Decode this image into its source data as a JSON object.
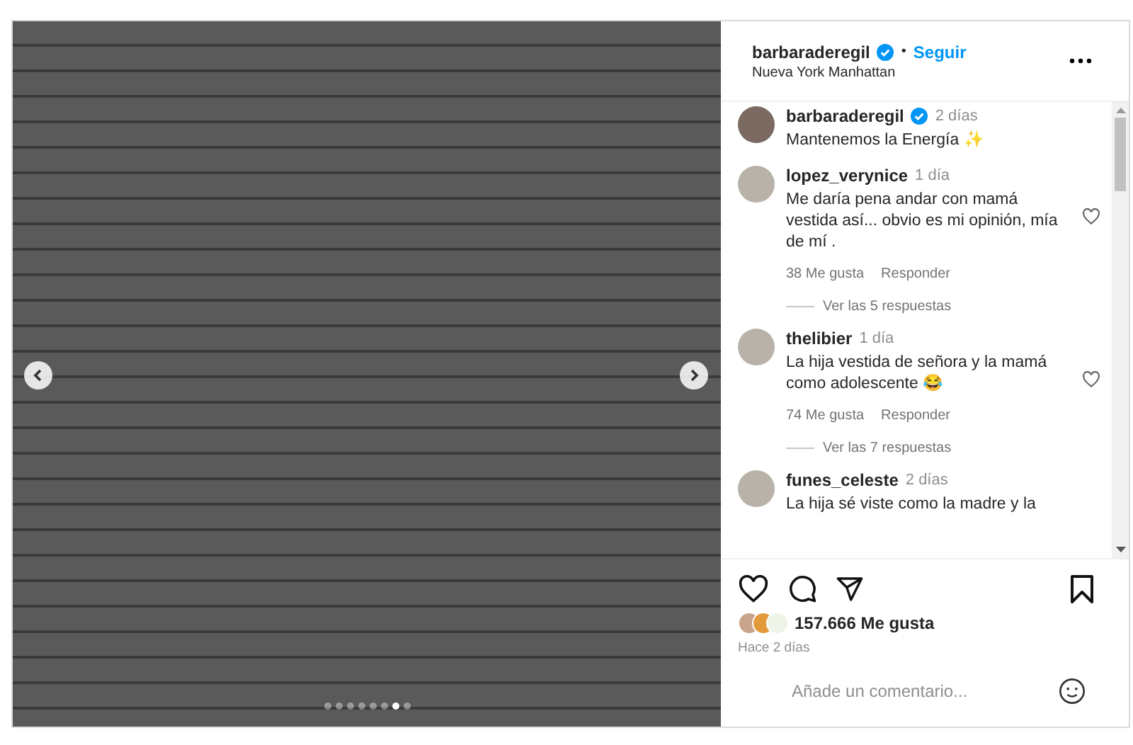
{
  "post": {
    "carousel_dots": [
      {
        "selected": false
      },
      {
        "selected": false
      },
      {
        "selected": false
      },
      {
        "selected": false
      },
      {
        "selected": false
      },
      {
        "selected": false
      },
      {
        "selected": true
      },
      {
        "selected": false
      }
    ]
  },
  "header": {
    "username": "barbaraderegil",
    "verified": true,
    "separator": "•",
    "follow": "Seguir",
    "location": "Nueva York Manhattan"
  },
  "caption": {
    "username": "barbaraderegil",
    "verified": true,
    "time": "2 días",
    "text": "Mantenemos la Energía ✨"
  },
  "comments": [
    {
      "username": "lopez_verynice",
      "time": "1 día",
      "text": "Me daría pena andar con mamá vestida así... obvio es mi opinión, mía de mí .",
      "likes": "38 Me gusta",
      "reply": "Responder",
      "replies": "Ver las 5 respuestas"
    },
    {
      "username": "thelibier",
      "time": "1 día",
      "text": "La hija vestida de señora y la mamá como adolescente 😂",
      "likes": "74 Me gusta",
      "reply": "Responder",
      "replies": "Ver las 7 respuestas"
    },
    {
      "username": "funes_celeste",
      "time": "2 días",
      "text": "La hija sé viste como la madre y la"
    }
  ],
  "likes": "157.666 Me gusta",
  "posted": "Hace 2 días",
  "comment_box": {
    "placeholder": "Añade un comentario..."
  }
}
